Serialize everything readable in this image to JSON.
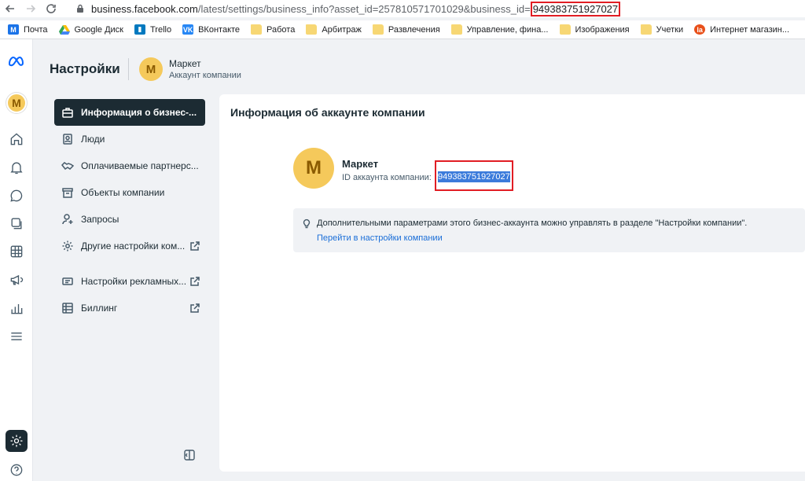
{
  "browser": {
    "url_host": "business.facebook.com",
    "url_path": "/latest/settings/business_info?asset_id=257810571701029&business_id=",
    "url_highlight": "949383751927027",
    "bookmarks": [
      {
        "label": "Почта",
        "icon": "gmail-icon",
        "color": "#1a73e8"
      },
      {
        "label": "Google Диск",
        "icon": "google-drive-icon",
        "color": "#34a853"
      },
      {
        "label": "Trello",
        "icon": "trello-icon",
        "color": "#0079bf"
      },
      {
        "label": "ВКонтакте",
        "icon": "vk-icon",
        "color": "#2787f5"
      },
      {
        "label": "Работа",
        "icon": "folder-icon"
      },
      {
        "label": "Арбитраж",
        "icon": "folder-icon"
      },
      {
        "label": "Развлечения",
        "icon": "folder-icon"
      },
      {
        "label": "Управление, фина...",
        "icon": "folder-icon"
      },
      {
        "label": "Изображения",
        "icon": "folder-icon"
      },
      {
        "label": "Учетки",
        "icon": "folder-icon"
      },
      {
        "label": "Интернет магазин...",
        "icon": "la-icon",
        "color": "#e8501a"
      }
    ]
  },
  "header": {
    "title": "Настройки",
    "business_initial": "M",
    "business_name": "Маркет",
    "business_subtitle": "Аккаунт компании"
  },
  "rail": {
    "avatar_initial": "M"
  },
  "menu": {
    "items": [
      {
        "label": "Информация о бизнес-...",
        "icon": "briefcase-icon",
        "active": true
      },
      {
        "label": "Люди",
        "icon": "people-icon"
      },
      {
        "label": "Оплачиваемые партнерс...",
        "icon": "handshake-icon"
      },
      {
        "label": "Объекты компании",
        "icon": "box-icon"
      },
      {
        "label": "Запросы",
        "icon": "person-add-icon"
      },
      {
        "label": "Другие настройки ком...",
        "icon": "gear-icon",
        "external": true
      },
      {
        "label": "Настройки рекламных...",
        "icon": "ad-settings-icon",
        "external": true
      },
      {
        "label": "Биллинг",
        "icon": "billing-icon",
        "external": true
      }
    ]
  },
  "main": {
    "title": "Информация об аккаунте компании",
    "account_initial": "M",
    "account_name": "Маркет",
    "id_label": "ID аккаунта компании:",
    "id_value": "949383751927027",
    "info_text": "Дополнительными параметрами этого бизнес-аккаунта можно управлять в разделе \"Настройки компании\".",
    "info_link": "Перейти в настройки компании"
  },
  "colors": {
    "accent_dark": "#1c2b33",
    "highlight_red": "#e11d24",
    "selection_blue": "#3b7bdb",
    "link": "#1a6ed8",
    "avatar_yellow": "#f5c95b"
  }
}
